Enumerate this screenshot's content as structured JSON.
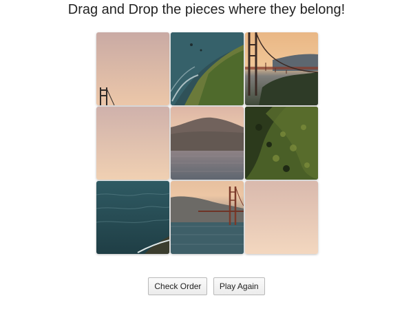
{
  "header": {
    "title": "Drag and Drop the pieces where they belong!"
  },
  "puzzle": {
    "rows": 3,
    "columns": 3,
    "tiles": [
      {
        "slot": 1,
        "scene": "sky-with-tower-top"
      },
      {
        "slot": 2,
        "scene": "coastline-cliff"
      },
      {
        "slot": 3,
        "scene": "bridge-tower-sunset"
      },
      {
        "slot": 4,
        "scene": "plain-sky"
      },
      {
        "slot": 5,
        "scene": "hill-over-water"
      },
      {
        "slot": 6,
        "scene": "green-hillside"
      },
      {
        "slot": 7,
        "scene": "ocean-waves"
      },
      {
        "slot": 8,
        "scene": "bridge-over-water"
      },
      {
        "slot": 9,
        "scene": "plain-sky-light"
      }
    ]
  },
  "controls": {
    "check_order_label": "Check Order",
    "play_again_label": "Play Again"
  }
}
